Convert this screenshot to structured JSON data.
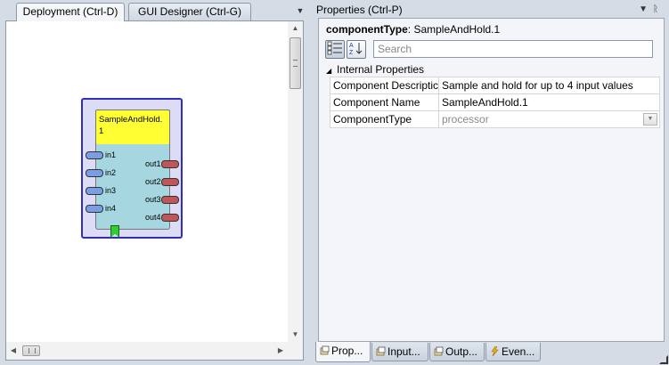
{
  "left_pane": {
    "tabs": [
      {
        "label": "Deployment (Ctrl-D)",
        "active": true
      },
      {
        "label": "GUI Designer (Ctrl-G)",
        "active": false
      }
    ],
    "tab_menu_icon": "dropdown-triangle-icon",
    "component": {
      "title": "SampleAndHold.1",
      "title_color": "#ffff33",
      "body_color": "#a6d7e0",
      "border_color": "#2f2fb8",
      "input_ports": [
        "in1",
        "in2",
        "in3",
        "in4"
      ],
      "output_ports": [
        "out1",
        "out2",
        "out3",
        "out4"
      ],
      "input_port_color": "#7a9ee6",
      "output_port_color": "#c0565a",
      "event_port_color": "#33cc33"
    }
  },
  "right_pane": {
    "header": "Properties (Ctrl-P)",
    "header_icons": [
      "dropdown-triangle-icon",
      "pin-icon"
    ],
    "title_key": "componentType",
    "title_value": ": SampleAndHold.1",
    "toolbar": {
      "categorized_icon": "categorized-icon",
      "sort_icon": "sort-az-icon",
      "search_placeholder": "Search"
    },
    "category": "Internal Properties",
    "properties": [
      {
        "name": "Component Descriptic",
        "value": "Sample and hold for up to 4 input values",
        "readonly": false
      },
      {
        "name": "Component Name",
        "value": "SampleAndHold.1",
        "readonly": false
      },
      {
        "name": "ComponentType",
        "value": "processor",
        "readonly": true,
        "dropdown": true
      }
    ],
    "bottom_tabs": [
      {
        "label": "Prop...",
        "icon": "properties-icon",
        "active": true
      },
      {
        "label": "Input...",
        "icon": "input-icon",
        "active": false
      },
      {
        "label": "Outp...",
        "icon": "output-icon",
        "active": false
      },
      {
        "label": "Even...",
        "icon": "event-icon",
        "active": false
      }
    ]
  }
}
